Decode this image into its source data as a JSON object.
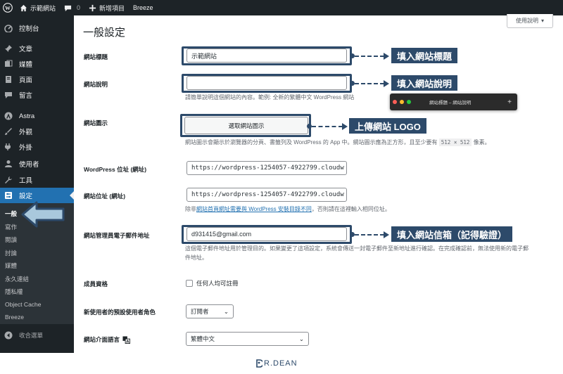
{
  "adminbar": {
    "site_name": "示範網站",
    "comments_count": "0",
    "new_label": "新增項目",
    "plugin_label": "Breeze"
  },
  "sidebar": {
    "items": [
      {
        "label": "控制台",
        "icon": "dashboard-icon"
      },
      {
        "label": "文章",
        "icon": "pin-icon"
      },
      {
        "label": "媒體",
        "icon": "media-icon"
      },
      {
        "label": "頁面",
        "icon": "page-icon"
      },
      {
        "label": "留言",
        "icon": "comment-icon"
      },
      {
        "label": "Astra",
        "icon": "astra-icon"
      },
      {
        "label": "外觀",
        "icon": "brush-icon"
      },
      {
        "label": "外掛",
        "icon": "plugin-icon"
      },
      {
        "label": "使用者",
        "icon": "user-icon"
      },
      {
        "label": "工具",
        "icon": "wrench-icon"
      },
      {
        "label": "設定",
        "icon": "settings-icon"
      }
    ],
    "submenu": [
      "一般",
      "寫作",
      "閱讀",
      "討論",
      "媒體",
      "永久連結",
      "隱私權",
      "Object Cache",
      "Breeze"
    ],
    "collapse_label": "收合選單"
  },
  "help_tab": "使用說明",
  "page_title": "一般設定",
  "form": {
    "site_title_label": "網站標題",
    "site_title_value": "示範網站",
    "tagline_label": "網站說明",
    "tagline_value": "",
    "tagline_desc": "請簡單說明這個網站的內容。範例: 全新的繁體中文 WordPress 網站",
    "site_icon_label": "網站圖示",
    "site_icon_button": "選取網站圖示",
    "site_icon_desc_a": "網站圖示會顯示於瀏覽器的分頁、書籤列及 WordPress 的 App 中。網站圖示應為正方形，且至少要有",
    "site_icon_size": "512 × 512",
    "site_icon_desc_b": "像素。",
    "wp_address_label": "WordPress 位址 (網址)",
    "wp_address_value": "https://wordpress-1254057-4922799.cloudw",
    "site_address_label": "網站位址 (網址)",
    "site_address_value": "https://wordpress-1254057-4922799.cloudw",
    "site_address_desc_a": "除非",
    "site_address_desc_link": "網站首頁網址需要與 WordPress 安裝目錄不同",
    "site_address_desc_b": "，否則請在這裡輸入相同位址。",
    "admin_email_label": "網站管理員電子郵件地址",
    "admin_email_value": "d931415@gmail.com",
    "admin_email_desc": "這個電子郵件地址用於管理目的。如果變更了這項設定，系統會傳送一封電子郵件至新地址進行確認。在完成確認前，無法使用新的電子郵件地址。",
    "membership_label": "成員資格",
    "membership_checkbox": "任何人均可註冊",
    "default_role_label": "新使用者的預設使用者角色",
    "default_role_value": "訂閱者",
    "language_label": "網站介面語言",
    "language_value": "繁體中文"
  },
  "annotations": {
    "callout_title": "填入網站標題",
    "callout_tagline": "填入網站說明",
    "callout_logo": "上傳網站 LOGO",
    "callout_email": "填入網站信箱（記得驗證）",
    "mini_window_title": "網站標題 – 網站說明"
  },
  "footer_logo": "R.DEAN",
  "colors": {
    "admin_dark": "#1d2327",
    "wp_blue": "#2271b1",
    "annotation_navy": "#2d4a6a"
  }
}
